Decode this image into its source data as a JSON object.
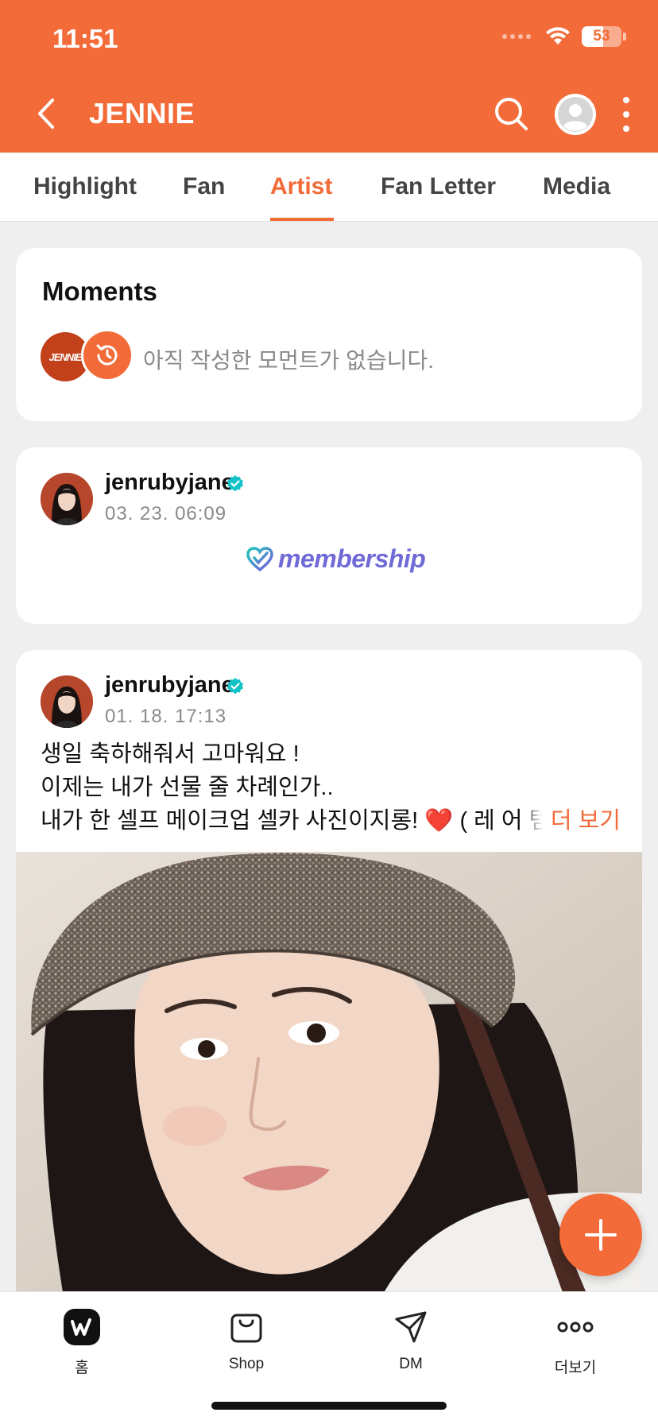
{
  "status_bar": {
    "time": "11:51",
    "battery": "53",
    "battery_level_percent": 53
  },
  "header": {
    "title": "JENNIE",
    "back_icon": "chevron-left-icon",
    "search_icon": "search-icon",
    "profile_icon": "user-avatar-icon",
    "more_icon": "more-vertical-icon",
    "color": "#f26b38"
  },
  "tabs": [
    {
      "label": "Highlight",
      "active": false
    },
    {
      "label": "Fan",
      "active": false
    },
    {
      "label": "Artist",
      "active": true
    },
    {
      "label": "Fan Letter",
      "active": false
    },
    {
      "label": "Media",
      "active": false
    }
  ],
  "moments": {
    "title": "Moments",
    "logo_text": "JENNIE",
    "empty_text": "아직 작성한 모먼트가 없습니다."
  },
  "posts": [
    {
      "author": "jenrubyjane",
      "verified": true,
      "date": "03. 23. 06:09",
      "membership_label": "membership"
    },
    {
      "author": "jenrubyjane",
      "verified": true,
      "date": "01. 18. 17:13",
      "lines": [
        "생일 축하해줘서 고마워요 !",
        "이제는 내가 선물 줄 차례인가..",
        "내가 한 셀프 메이크업 셀카 사진이지롱! ❤️ ( 레 어 템"
      ],
      "read_more": "더 보기"
    }
  ],
  "fab_icon": "plus-icon",
  "bottom_nav": [
    {
      "label": "홈",
      "icon": "weverse-home-icon"
    },
    {
      "label": "Shop",
      "icon": "shopping-bag-icon"
    },
    {
      "label": "DM",
      "icon": "send-icon"
    },
    {
      "label": "더보기",
      "icon": "more-horizontal-icon"
    }
  ]
}
